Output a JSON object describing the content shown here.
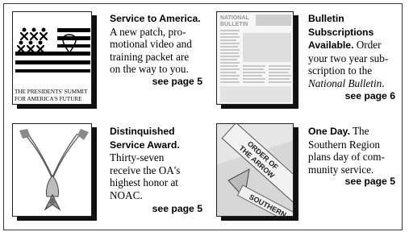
{
  "items": [
    {
      "head": "Service to America.",
      "lines": [
        "A new patch, pro-",
        "motional video and",
        "training packet are",
        "on the way to you."
      ],
      "ref": "see page 5",
      "thumb_caption": [
        "THE PRESIDENTS' SUMMIT",
        "FOR AMERICA'S FUTURE"
      ]
    },
    {
      "head_lines": [
        "Bulletin",
        "Subscriptions",
        "Available."
      ],
      "lines_after_head": " Order",
      "lines": [
        "your two year sub-",
        "scription to the"
      ],
      "italic": "National Bulletin",
      "italic_after": ".",
      "ref": "see page 6",
      "thumb_title": "NATIONAL BULLETIN"
    },
    {
      "head_lines": [
        "Distinquished",
        "Service Award."
      ],
      "lines": [
        "Thirty-seven",
        "receive the OA's",
        "highest honor at",
        "NOAC."
      ],
      "ref": "see page 5"
    },
    {
      "head": "One Day.",
      "head_after": " The",
      "lines": [
        "Southern Region",
        "plans day of com-",
        "munity service."
      ],
      "ref": "see page 5",
      "thumb_words": [
        "ORDER OF",
        "THE ARROW",
        "SOUTHERN"
      ]
    }
  ]
}
